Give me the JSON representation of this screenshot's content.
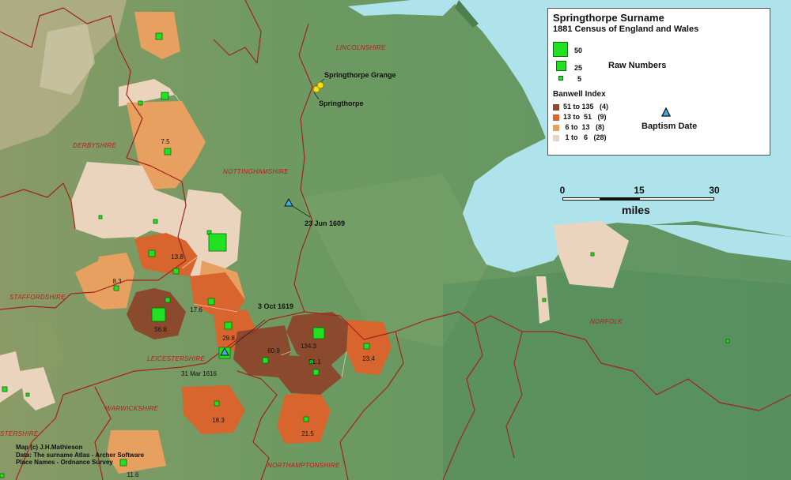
{
  "legend": {
    "title": "Springthorpe Surname",
    "subtitle": "1881 Census of England and Wales",
    "raw_numbers_title": "Raw Numbers",
    "raw_sizes": [
      {
        "label": "50",
        "value": 50
      },
      {
        "label": "25",
        "value": 25
      },
      {
        "label": "5",
        "value": 5
      }
    ],
    "banwell_title": "Banwell Index",
    "banwell_classes": [
      {
        "label": "51 to 135",
        "count": "(4)",
        "color": "#8b4a2e"
      },
      {
        "label": "13 to  51",
        "count": "(9)",
        "color": "#d8652e"
      },
      {
        "label": " 6 to  13",
        "count": "(8)",
        "color": "#e8a060"
      },
      {
        "label": " 1 to   6",
        "count": "(28)",
        "color": "#ebd4bd"
      }
    ],
    "baptism_label": "Baptism Date"
  },
  "scale": {
    "ticks": [
      "0",
      "15",
      "30"
    ],
    "unit": "miles"
  },
  "counties": [
    "LINCOLNSHIRE",
    "DERBYSHIRE",
    "NOTTINGHAMSHIRE",
    "STAFFORDSHIRE",
    "LEICESTERSHIRE",
    "WARWICKSHIRE",
    "NORTHAMPTONSHIRE",
    "NORFOLK",
    "STERSHIRE"
  ],
  "places": [
    "Springthorpe Grange",
    "Springthorpe"
  ],
  "index_values": [
    "7.5",
    "13.8",
    "8.3",
    "56.8",
    "17.6",
    "29.8",
    "60.9",
    "134.3",
    "51.1",
    "23.4",
    "18.3",
    "21.5",
    "11.6"
  ],
  "baptisms": [
    "23 Jun 1609",
    "3 Oct 1619",
    "31 Mar 1616"
  ],
  "credits": [
    "Map (c) J.H.Mathieson",
    "Data: The surname Atlas - Archer Software",
    "Place Names - Ordnance Survey"
  ],
  "colors": {
    "sea": "#aee3ec",
    "land": "#6f9a6a",
    "boundary": "#a3241c",
    "marker": "#22e022",
    "place_marker": "#f5e010"
  }
}
